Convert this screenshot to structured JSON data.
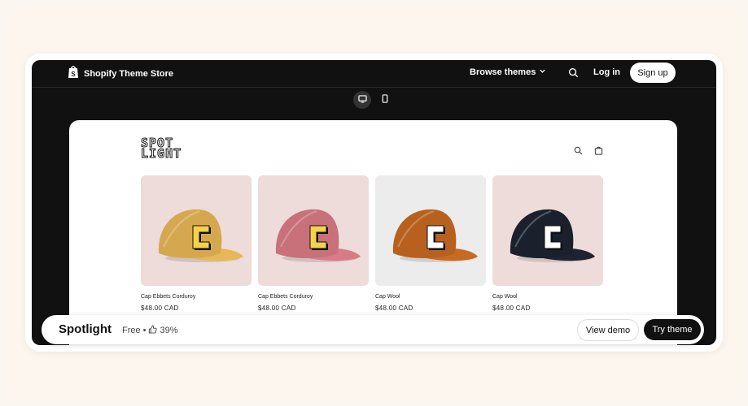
{
  "header": {
    "logo_text": "Shopify Theme Store",
    "browse_label": "Browse themes",
    "login_label": "Log in",
    "signup_label": "Sign up"
  },
  "device_toggle": {
    "options": [
      "desktop",
      "mobile"
    ],
    "selected": "desktop"
  },
  "preview": {
    "store_logo_line1": "SPOT",
    "store_logo_line2": "LIGHT",
    "products": [
      {
        "name": "Cap Ebbets Corduroy",
        "price": "$48.00 CAD",
        "cap_color": "#e8b756",
        "bg_color": "#eddcd9",
        "badge_color": "#f6d24a"
      },
      {
        "name": "Cap Ebbets Corduroy",
        "price": "$48.00 CAD",
        "cap_color": "#d97b85",
        "bg_color": "#eddcd9",
        "badge_color": "#f3d34d"
      },
      {
        "name": "Cap Wool",
        "price": "$48.00 CAD",
        "cap_color": "#c86a22",
        "bg_color": "#ececec",
        "badge_color": "#ffffff"
      },
      {
        "name": "Cap Wool",
        "price": "$48.00 CAD",
        "cap_color": "#1d2330",
        "bg_color": "#eddcd9",
        "badge_color": "#ffffff"
      }
    ]
  },
  "footer_bar": {
    "theme_name": "Spotlight",
    "price": "Free",
    "separator": "•",
    "rating": "39%",
    "view_demo_label": "View demo",
    "try_theme_label": "Try theme"
  }
}
